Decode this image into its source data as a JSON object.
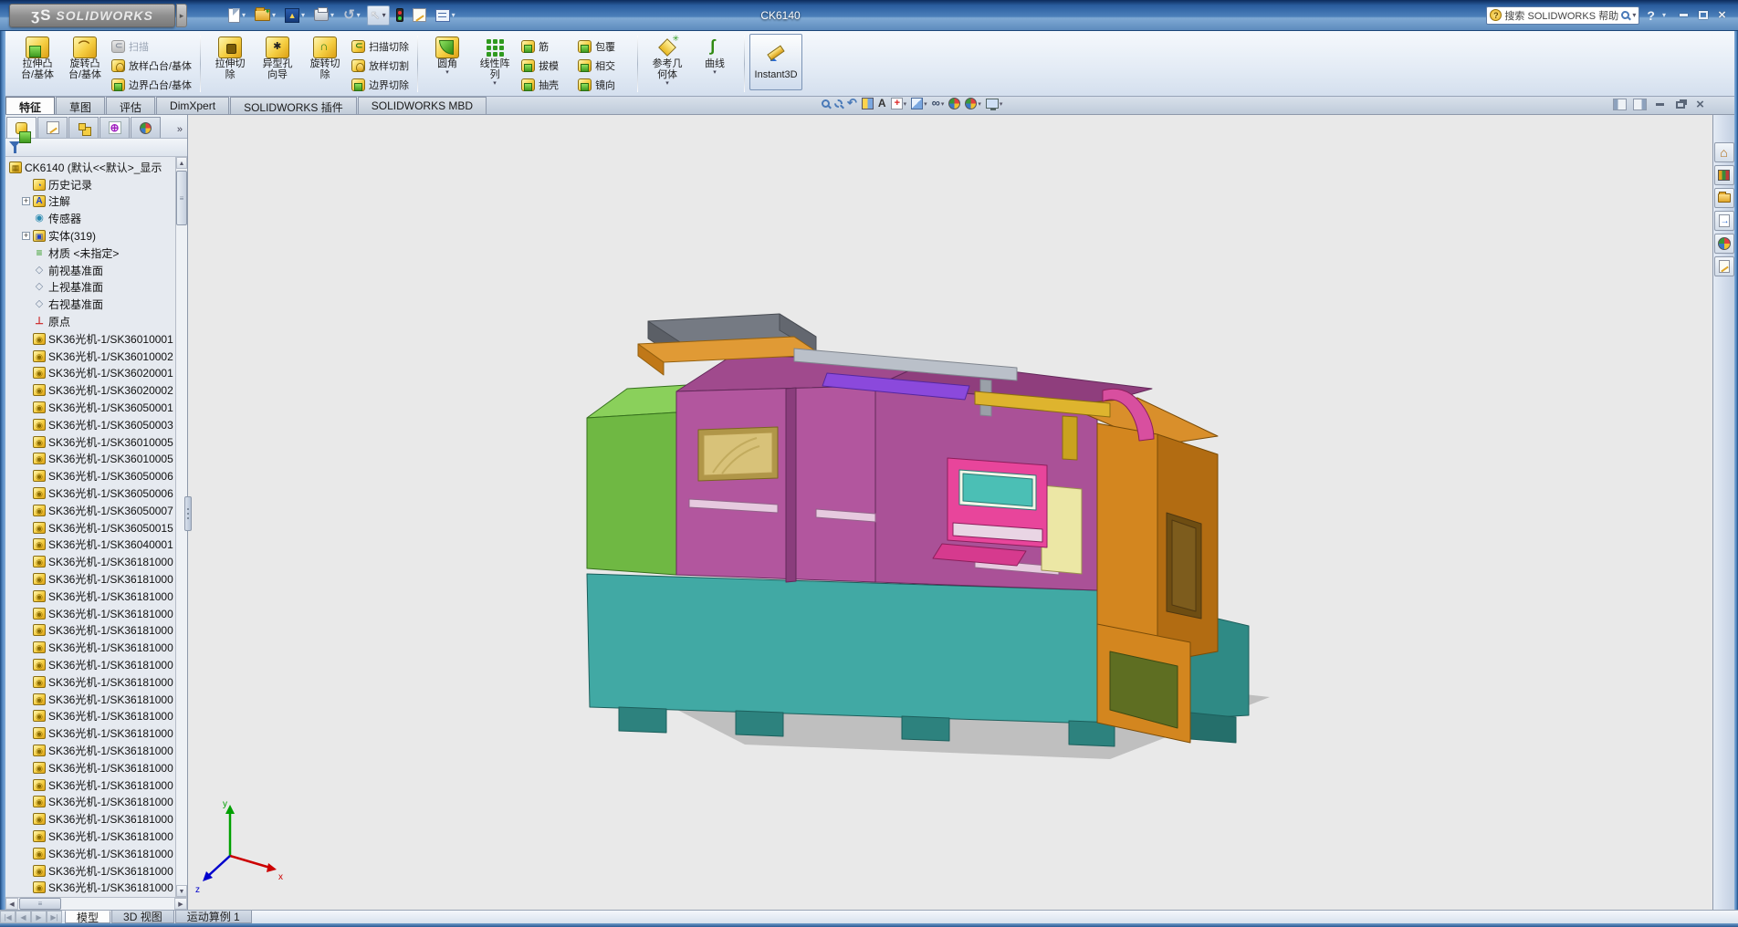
{
  "titlebar": {
    "logo": "SOLIDWORKS",
    "logo_prefix": "ʒS",
    "title": "CK6140",
    "search_placeholder": "搜索 SOLIDWORKS 帮助",
    "toolbar_icons": [
      "new-document",
      "open",
      "edrawings-publish",
      "print",
      "undo",
      "select-arrow",
      "selection-filter",
      "options",
      "task-list"
    ]
  },
  "ribbon": {
    "group1": {
      "bigs": [
        {
          "l1": "拉伸凸",
          "l2": "台/基体",
          "icon": "i-extrude",
          "arr": ""
        },
        {
          "l1": "旋转凸",
          "l2": "台/基体",
          "icon": "i-revolve",
          "arr": ""
        }
      ],
      "smalls": [
        {
          "label": "扫描",
          "icon": "s-dis",
          "state": "dis"
        },
        {
          "label": "放样凸台/基体",
          "icon": "s-loft",
          "state": ""
        },
        {
          "label": "边界凸台/基体",
          "icon": "s-generic",
          "state": ""
        }
      ]
    },
    "group2": {
      "bigs": [
        {
          "l1": "拉伸切",
          "l2": "除",
          "icon": "i-cut",
          "arr": ""
        },
        {
          "l1": "异型孔",
          "l2": "向导",
          "icon": "i-hole",
          "arr": ""
        },
        {
          "l1": "旋转切",
          "l2": "除",
          "icon": "i-revcut",
          "arr": ""
        }
      ],
      "smalls": [
        {
          "label": "扫描切除",
          "icon": "s-green-c",
          "state": ""
        },
        {
          "label": "放样切割",
          "icon": "s-loft",
          "state": ""
        },
        {
          "label": "边界切除",
          "icon": "s-generic",
          "state": ""
        }
      ]
    },
    "group3": {
      "bigs": [
        {
          "l1": "圆角",
          "l2": "",
          "icon": "i-fillet",
          "arr": "on"
        },
        {
          "l1": "线性阵",
          "l2": "列",
          "icon": "i-pattern",
          "arr": "on"
        }
      ],
      "smalls1": [
        {
          "label": "筋",
          "icon": "s-generic",
          "state": ""
        },
        {
          "label": "拔模",
          "icon": "s-generic",
          "state": ""
        },
        {
          "label": "抽壳",
          "icon": "s-generic",
          "state": ""
        }
      ],
      "smalls2": [
        {
          "label": "包覆",
          "icon": "s-generic",
          "state": ""
        },
        {
          "label": "相交",
          "icon": "s-generic",
          "state": ""
        },
        {
          "label": "镜向",
          "icon": "s-generic",
          "state": ""
        }
      ]
    },
    "group4": {
      "bigs": [
        {
          "l1": "参考几",
          "l2": "何体",
          "icon": "i-refgeo",
          "arr": "on"
        },
        {
          "l1": "曲线",
          "l2": "",
          "icon": "i-curve",
          "arr": "on"
        }
      ]
    },
    "instant3d": {
      "label": "Instant3D",
      "icon": "i-i3d"
    }
  },
  "feature_tabs": [
    {
      "label": "特征",
      "state": "active"
    },
    {
      "label": "草图",
      "state": ""
    },
    {
      "label": "评估",
      "state": ""
    },
    {
      "label": "DimXpert",
      "state": ""
    },
    {
      "label": "SOLIDWORKS 插件",
      "state": ""
    },
    {
      "label": "SOLIDWORKS MBD",
      "state": ""
    }
  ],
  "headsup_icons": [
    "zoom-fit",
    "zoom-area",
    "previous-view",
    "section-view",
    "3d-drawing-view",
    "view-orientation",
    "display-style",
    "hide-show-items",
    "edit-appearance",
    "apply-scene",
    "view-settings"
  ],
  "panel": {
    "manager_tabs": [
      "featuremanager",
      "propertymanager",
      "configurationmanager",
      "dimxpertmanager",
      "displaymanager"
    ],
    "more_label": "»"
  },
  "tree": {
    "root": "CK6140  (默认<<默认>_显示",
    "items": [
      {
        "label": "历史记录",
        "icon": "tc-history tbox",
        "exp": ""
      },
      {
        "label": "注解",
        "icon": "tc-ann tbox",
        "exp": "on"
      },
      {
        "label": "传感器",
        "icon": "tc-sensor",
        "exp": ""
      },
      {
        "label": "实体(319)",
        "icon": "tc-solids tbox",
        "exp": "on"
      },
      {
        "label": "材质 <未指定>",
        "icon": "tc-material",
        "exp": ""
      },
      {
        "label": "前视基准面",
        "icon": "tc-plane",
        "exp": ""
      },
      {
        "label": "上视基准面",
        "icon": "tc-plane",
        "exp": ""
      },
      {
        "label": "右视基准面",
        "icon": "tc-plane",
        "exp": ""
      },
      {
        "label": "原点",
        "icon": "tc-origin",
        "exp": ""
      },
      {
        "label": "SK36光机-1/SK36010001",
        "icon": "tc-body tbox",
        "exp": ""
      },
      {
        "label": "SK36光机-1/SK36010002",
        "icon": "tc-body tbox",
        "exp": ""
      },
      {
        "label": "SK36光机-1/SK36020001",
        "icon": "tc-body tbox",
        "exp": ""
      },
      {
        "label": "SK36光机-1/SK36020002",
        "icon": "tc-body tbox",
        "exp": ""
      },
      {
        "label": "SK36光机-1/SK36050001",
        "icon": "tc-body tbox",
        "exp": ""
      },
      {
        "label": "SK36光机-1/SK36050003",
        "icon": "tc-body tbox",
        "exp": ""
      },
      {
        "label": "SK36光机-1/SK36010005",
        "icon": "tc-body tbox",
        "exp": ""
      },
      {
        "label": "SK36光机-1/SK36010005",
        "icon": "tc-body tbox",
        "exp": ""
      },
      {
        "label": "SK36光机-1/SK36050006",
        "icon": "tc-body tbox",
        "exp": ""
      },
      {
        "label": "SK36光机-1/SK36050006",
        "icon": "tc-body tbox",
        "exp": ""
      },
      {
        "label": "SK36光机-1/SK36050007",
        "icon": "tc-body tbox",
        "exp": ""
      },
      {
        "label": "SK36光机-1/SK36050015",
        "icon": "tc-body tbox",
        "exp": ""
      },
      {
        "label": "SK36光机-1/SK36040001",
        "icon": "tc-body tbox",
        "exp": ""
      },
      {
        "label": "SK36光机-1/SK36181000",
        "icon": "tc-body tbox",
        "exp": ""
      },
      {
        "label": "SK36光机-1/SK36181000",
        "icon": "tc-body tbox",
        "exp": ""
      },
      {
        "label": "SK36光机-1/SK36181000",
        "icon": "tc-body tbox",
        "exp": ""
      },
      {
        "label": "SK36光机-1/SK36181000",
        "icon": "tc-body tbox",
        "exp": ""
      },
      {
        "label": "SK36光机-1/SK36181000",
        "icon": "tc-body tbox",
        "exp": ""
      },
      {
        "label": "SK36光机-1/SK36181000",
        "icon": "tc-body tbox",
        "exp": ""
      },
      {
        "label": "SK36光机-1/SK36181000",
        "icon": "tc-body tbox",
        "exp": ""
      },
      {
        "label": "SK36光机-1/SK36181000",
        "icon": "tc-body tbox",
        "exp": ""
      },
      {
        "label": "SK36光机-1/SK36181000",
        "icon": "tc-body tbox",
        "exp": ""
      },
      {
        "label": "SK36光机-1/SK36181000",
        "icon": "tc-body tbox",
        "exp": ""
      },
      {
        "label": "SK36光机-1/SK36181000",
        "icon": "tc-body tbox",
        "exp": ""
      },
      {
        "label": "SK36光机-1/SK36181000",
        "icon": "tc-body tbox",
        "exp": ""
      },
      {
        "label": "SK36光机-1/SK36181000",
        "icon": "tc-body tbox",
        "exp": ""
      },
      {
        "label": "SK36光机-1/SK36181000",
        "icon": "tc-body tbox",
        "exp": ""
      },
      {
        "label": "SK36光机-1/SK36181000",
        "icon": "tc-body tbox",
        "exp": ""
      },
      {
        "label": "SK36光机-1/SK36181000",
        "icon": "tc-body tbox",
        "exp": ""
      },
      {
        "label": "SK36光机-1/SK36181000",
        "icon": "tc-body tbox",
        "exp": ""
      },
      {
        "label": "SK36光机-1/SK36181000",
        "icon": "tc-body tbox",
        "exp": ""
      },
      {
        "label": "SK36光机-1/SK36181000",
        "icon": "tc-body tbox",
        "exp": ""
      },
      {
        "label": "SK36光机-1/SK36181000",
        "icon": "tc-body tbox",
        "exp": ""
      }
    ]
  },
  "taskpane_icons": [
    "solidworks-resources",
    "design-library",
    "file-explorer",
    "view-palette",
    "appearances",
    "custom-properties"
  ],
  "statusbar": {
    "tabs": [
      {
        "label": "模型",
        "state": "active"
      },
      {
        "label": "3D 视图",
        "state": ""
      },
      {
        "label": "运动算例 1",
        "state": ""
      }
    ]
  },
  "colors": {
    "titlebar_blue": "#2a5d9f",
    "ribbon_bg": "#e3ebf5",
    "viewport_bg": "#e9e9e9",
    "machine": {
      "base_teal": "#41a9a4",
      "panel_green": "#6fb843",
      "panel_magenta": "#b2569e",
      "body_orange": "#d3861f",
      "pendant_pink": "#e8459b",
      "screen_teal": "#4bbfb5",
      "window_yellow": "#d8c279",
      "accent_purple": "#8b49dc",
      "arm_yellow": "#deb42e"
    },
    "triad": {
      "x_axis": "#cc0000",
      "y_axis": "#00a000",
      "z_axis": "#0000cc"
    }
  }
}
